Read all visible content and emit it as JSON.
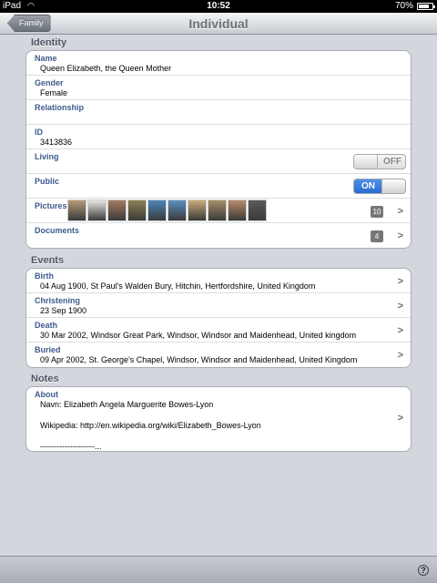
{
  "status_bar": {
    "carrier": "iPad",
    "time": "10:52",
    "battery": "70%"
  },
  "nav": {
    "title": "Individual",
    "back_label": "Family"
  },
  "identity": {
    "header": "Identity",
    "name_label": "Name",
    "name_value": "Queen Elizabeth, the Queen Mother",
    "gender_label": "Gender",
    "gender_value": "Female",
    "relationship_label": "Relationship",
    "relationship_value": "",
    "id_label": "ID",
    "id_value": "3413836",
    "living_label": "Living",
    "living_toggle": "OFF",
    "public_label": "Public",
    "public_toggle": "ON",
    "pictures_label": "Pictures",
    "pictures_count": "10",
    "documents_label": "Documents",
    "documents_count": "4"
  },
  "thumbnail_colors": [
    "#b69a78",
    "#e8e6e2",
    "#a37a60",
    "#8a8053",
    "#4a86b8",
    "#5a8fc0",
    "#c8aa7a",
    "#a58f66",
    "#b68b69",
    "#5a5a5a"
  ],
  "events": {
    "header": "Events",
    "items": [
      {
        "label": "Birth",
        "value": "04 Aug 1900, St Paul's Walden Bury, Hitchin, Hertfordshire, United Kingdom"
      },
      {
        "label": "Christening",
        "value": "23 Sep 1900"
      },
      {
        "label": "Death",
        "value": "30 Mar 2002, Windsor Great Park, Windsor, Windsor and Maidenhead, United kingdom"
      },
      {
        "label": "Buried",
        "value": "09 Apr 2002, St. George's Chapel, Windsor, Windsor and Maidenhead, United Kingdom"
      }
    ]
  },
  "notes": {
    "header": "Notes",
    "about_label": "About",
    "about_text": "Navn: Elizabeth Angela Marguerite Bowes-Lyon\n\nWikipedia: http://en.wikipedia.org/wiki/Elizabeth_Bowes-Lyon\n\n--------------------..."
  },
  "toolbar": {
    "help": "?"
  }
}
